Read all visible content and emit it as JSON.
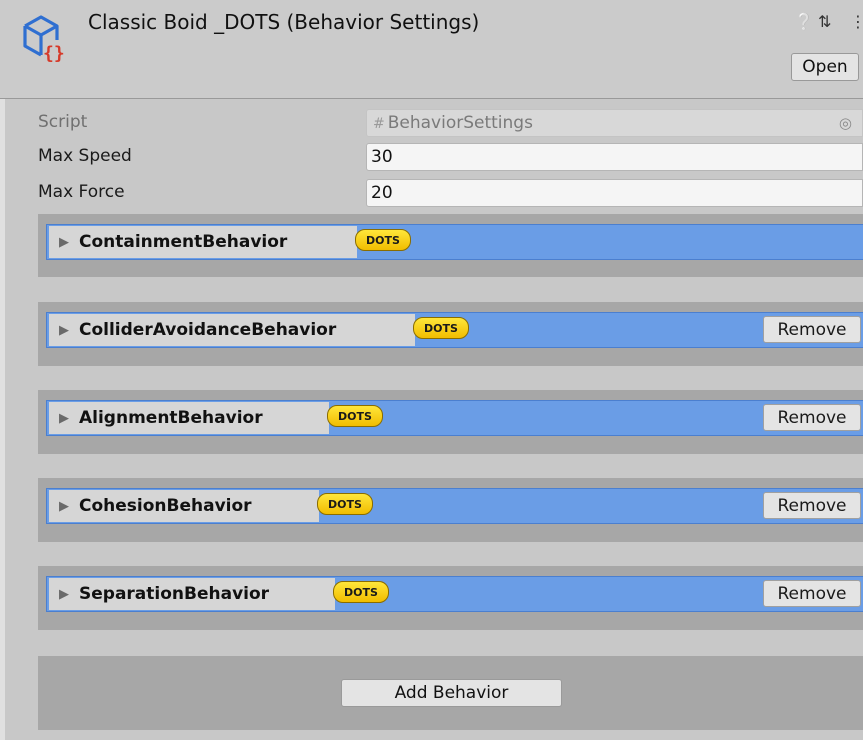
{
  "header": {
    "title": "Classic Boid _DOTS (Behavior Settings)",
    "open_label": "Open",
    "icons": [
      "script-icon",
      "help-icon",
      "presets-icon",
      "kebab-menu-icon"
    ]
  },
  "properties": {
    "script": {
      "label": "Script",
      "value": "BehaviorSettings"
    },
    "max_speed": {
      "label": "Max Speed",
      "value": "30"
    },
    "max_force": {
      "label": "Max Force",
      "value": "20"
    }
  },
  "behaviors": [
    {
      "name": "ContainmentBehavior",
      "badge": "DOTS",
      "remove_label": ""
    },
    {
      "name": "ColliderAvoidanceBehavior",
      "badge": "DOTS",
      "remove_label": "Remove"
    },
    {
      "name": "AlignmentBehavior",
      "badge": "DOTS",
      "remove_label": "Remove"
    },
    {
      "name": "CohesionBehavior",
      "badge": "DOTS",
      "remove_label": "Remove"
    },
    {
      "name": "SeparationBehavior",
      "badge": "DOTS",
      "remove_label": "Remove"
    }
  ],
  "add_behavior_label": "Add Behavior",
  "colors": {
    "behavior_header": "#6a9de6",
    "dots_badge": "#f5cd10",
    "panel_bg": "#c8c8c8",
    "block_bg": "#a7a7a7"
  }
}
